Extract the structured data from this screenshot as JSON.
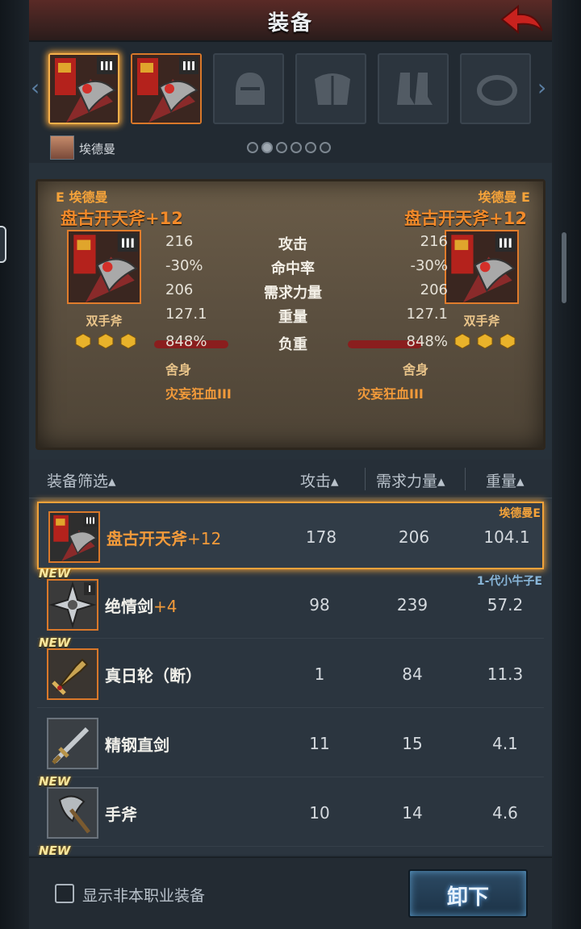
{
  "header": {
    "title": "装备"
  },
  "slots": {
    "filled_badge": "III",
    "character_name": "埃德曼",
    "page_dots": 6,
    "active_dot": 1
  },
  "compare": {
    "left_owner": "E 埃德曼",
    "right_owner": "埃德曼 E",
    "left_item": "盘古开天斧+12",
    "right_item": "盘古开天斧+12",
    "badge": "III",
    "type": "双手斧",
    "stats": [
      {
        "label": "攻击",
        "left": "216",
        "right": "216"
      },
      {
        "label": "命中率",
        "left": "-30%",
        "right": "-30%"
      },
      {
        "label": "需求力量",
        "left": "206",
        "right": "206"
      },
      {
        "label": "重量",
        "left": "127.1",
        "right": "127.1"
      },
      {
        "label": "负重",
        "left": "848%",
        "right": "848%"
      }
    ],
    "skill1": "舍身",
    "skill2": "灾妄狂血III"
  },
  "list": {
    "headers": {
      "filter": "装备筛选",
      "attack": "攻击",
      "strength": "需求力量",
      "weight": "重量"
    },
    "rows": [
      {
        "name": "盘古开天斧",
        "plus": "+12",
        "attack": "178",
        "strength": "206",
        "weight": "104.1",
        "owner": "埃德曼E",
        "new": "",
        "badge": "III"
      },
      {
        "name": "绝情剑",
        "plus": "+4",
        "attack": "98",
        "strength": "239",
        "weight": "57.2",
        "owner": "1-代小牛子E",
        "new": "NEW",
        "badge": "I"
      },
      {
        "name": "真日轮（断）",
        "plus": "",
        "attack": "1",
        "strength": "84",
        "weight": "11.3",
        "owner": "",
        "new": "NEW",
        "badge": ""
      },
      {
        "name": "精钢直剑",
        "plus": "",
        "attack": "11",
        "strength": "15",
        "weight": "4.1",
        "owner": "",
        "new": "",
        "badge": ""
      },
      {
        "name": "手斧",
        "plus": "",
        "attack": "10",
        "strength": "14",
        "weight": "4.6",
        "owner": "",
        "new": "NEW",
        "badge": ""
      }
    ],
    "partial_new": "NEW"
  },
  "footer": {
    "checkbox_label": "显示非本职业装备",
    "unequip_label": "卸下"
  },
  "colors": {
    "accent_orange": "#f29a3a",
    "owner": "#f5a33a",
    "button": "#2c4a64"
  }
}
